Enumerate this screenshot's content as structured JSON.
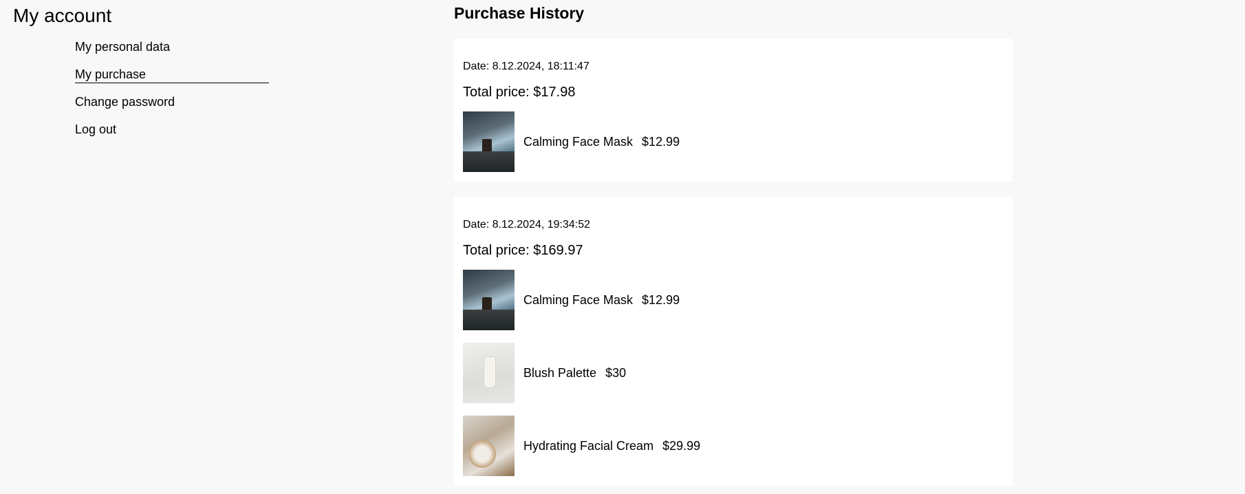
{
  "sidebar": {
    "title": "My account",
    "menu": [
      {
        "label": "My personal data"
      },
      {
        "label": "My purchase"
      },
      {
        "label": "Change password"
      },
      {
        "label": "Log out"
      }
    ]
  },
  "main": {
    "title": "Purchase History",
    "purchases": [
      {
        "date": "Date: 8.12.2024, 18:11:47",
        "total": "Total price: $17.98",
        "items": [
          {
            "name": "Calming Face Mask",
            "price": "$12.99",
            "image": "product-image"
          }
        ]
      },
      {
        "date": "Date: 8.12.2024, 19:34:52",
        "total": "Total price: $169.97",
        "items": [
          {
            "name": "Calming Face Mask",
            "price": "$12.99",
            "image": "product-image"
          },
          {
            "name": "Blush Palette",
            "price": "$30",
            "image": "product-image"
          },
          {
            "name": "Hydrating Facial Cream",
            "price": "$29.99",
            "image": "product-image"
          }
        ]
      }
    ]
  }
}
